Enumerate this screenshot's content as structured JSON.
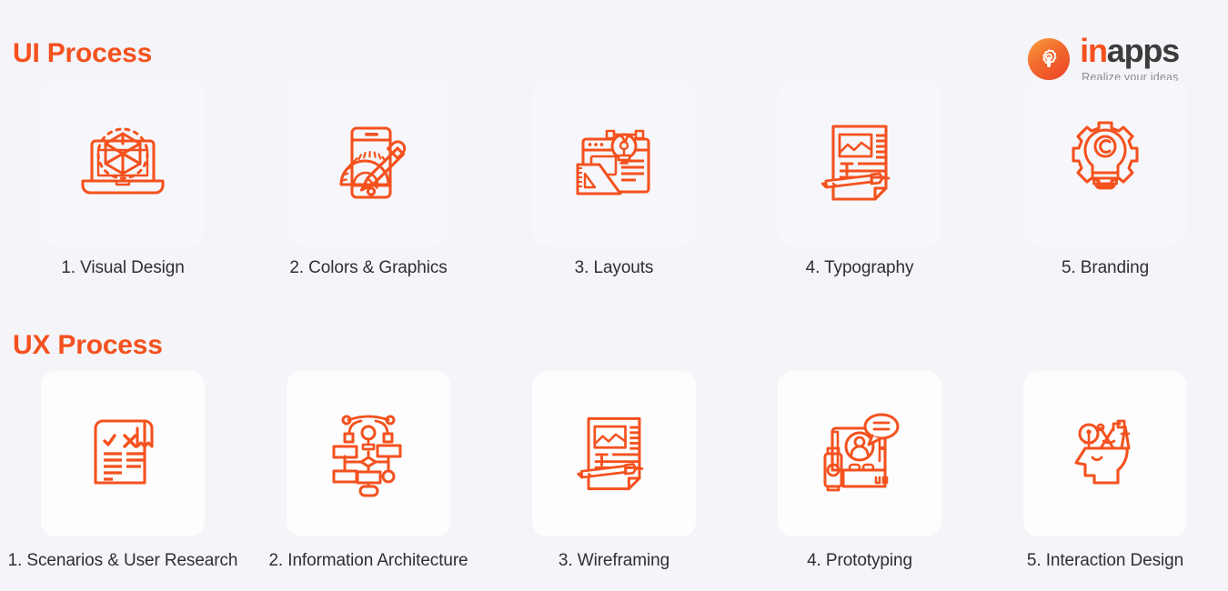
{
  "logo": {
    "name_part1": "in",
    "name_part2": "apps",
    "tagline": "Realize your ideas",
    "badge_icon": "gear-pin-icon",
    "colors": {
      "orange": "#f4511e",
      "dark": "#3c3c3c",
      "tagline": "#8a8a92"
    }
  },
  "page": {
    "background": "#f4f4f9",
    "accent": "#f4511e",
    "label_color": "#2f2f33"
  },
  "sections": [
    {
      "id": "ui",
      "title": "UI Process",
      "card_background": "#f7f7fb",
      "items": [
        {
          "label": "1. Visual Design",
          "icon": "laptop-3d-cube-icon"
        },
        {
          "label": "2. Colors & Graphics",
          "icon": "phone-protractor-pencil-icon"
        },
        {
          "label": "3. Layouts",
          "icon": "browser-lightbulb-ruler-icon"
        },
        {
          "label": "4. Typography",
          "icon": "document-typography-pen-icon"
        },
        {
          "label": "5. Branding",
          "icon": "gear-lightbulb-copyright-icon"
        }
      ]
    },
    {
      "id": "ux",
      "title": "UX Process",
      "card_background": "#fdfdfe",
      "items": [
        {
          "label": "1. Scenarios & User Research",
          "icon": "scroll-check-cross-icon"
        },
        {
          "label": "2. Information Architecture",
          "icon": "sitemap-lightbulb-icon"
        },
        {
          "label": "3. Wireframing",
          "icon": "document-typography-pen-icon"
        },
        {
          "label": "4. Prototyping",
          "icon": "user-card-speech-bubble-icon"
        },
        {
          "label": "5. Interaction Design",
          "icon": "head-profile-tools-icon"
        }
      ]
    }
  ]
}
